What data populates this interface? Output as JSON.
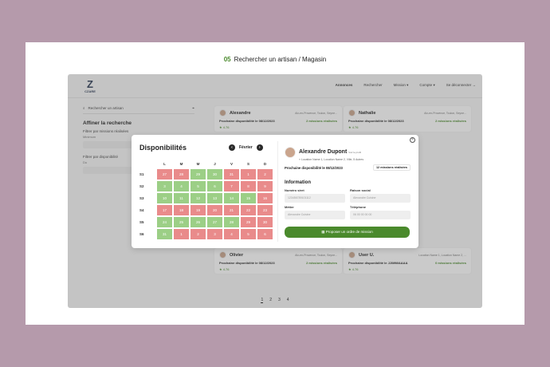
{
  "heading": {
    "number": "05",
    "title": "Rechercher un artisan / Magasin"
  },
  "logo": {
    "mark": "Z",
    "text": "CZARE"
  },
  "nav": {
    "items": [
      "Annonces",
      "Rechercher",
      "Mission",
      "Compte",
      "Se déconnecter"
    ],
    "active_index": 0
  },
  "search": {
    "placeholder": "Rechercher un artisan"
  },
  "filters": {
    "title": "Affiner la recherche",
    "missions_label": "Filtrer par missions réalisées",
    "missions_sub": "Minimum",
    "availability_label": "Filtrer par disponibilité",
    "availability_sub": "Du"
  },
  "cards": [
    {
      "name": "Alexandre",
      "location": "Aix-en-Provence, Toulon, Seyne...",
      "availability": "Prochaine disponibilité le 08/12/2023",
      "missions": "2 missions réalisées",
      "rating": "4.76"
    },
    {
      "name": "Nathalie",
      "location": "Aix-en-Provence, Toulon, Seyne...",
      "availability": "Prochaine disponibilité le 08/12/2023",
      "missions": "2 missions réalisées",
      "rating": "4.76"
    },
    {
      "name": "Olivier",
      "location": "Aix-en-Provence, Toulon, Seyne...",
      "availability": "Prochaine disponibilité le 08/12/2023",
      "missions": "2 missions réalisées",
      "rating": "4.76"
    },
    {
      "name": "User U.",
      "location": "Location Name 1, Location Name 2, ...",
      "availability": "Prochaine disponibilité le JJ/MM/AAAA",
      "missions": "0 missions réalisées",
      "rating": "4.76"
    }
  ],
  "pagination": {
    "pages": [
      "1",
      "2",
      "3",
      "4"
    ],
    "current": "1"
  },
  "modal": {
    "calendar": {
      "title": "Disponibilités",
      "month": "Février",
      "weekdays": [
        "L",
        "M",
        "M",
        "J",
        "V",
        "S",
        "D"
      ],
      "weeks": [
        {
          "label": "S1",
          "days": [
            {
              "d": "27",
              "s": "red"
            },
            {
              "d": "28",
              "s": "red"
            },
            {
              "d": "29",
              "s": "green"
            },
            {
              "d": "30",
              "s": "green"
            },
            {
              "d": "31",
              "s": "red"
            },
            {
              "d": "1",
              "s": "red"
            },
            {
              "d": "2",
              "s": "red"
            }
          ]
        },
        {
          "label": "S2",
          "days": [
            {
              "d": "3",
              "s": "green"
            },
            {
              "d": "4",
              "s": "green"
            },
            {
              "d": "5",
              "s": "green"
            },
            {
              "d": "6",
              "s": "green"
            },
            {
              "d": "7",
              "s": "red"
            },
            {
              "d": "8",
              "s": "red"
            },
            {
              "d": "9",
              "s": "red"
            }
          ]
        },
        {
          "label": "S3",
          "days": [
            {
              "d": "10",
              "s": "green"
            },
            {
              "d": "11",
              "s": "green"
            },
            {
              "d": "12",
              "s": "green"
            },
            {
              "d": "13",
              "s": "green"
            },
            {
              "d": "14",
              "s": "green"
            },
            {
              "d": "15",
              "s": "green"
            },
            {
              "d": "16",
              "s": "red"
            }
          ]
        },
        {
          "label": "S4",
          "days": [
            {
              "d": "17",
              "s": "red"
            },
            {
              "d": "18",
              "s": "red"
            },
            {
              "d": "19",
              "s": "red"
            },
            {
              "d": "20",
              "s": "red"
            },
            {
              "d": "21",
              "s": "red"
            },
            {
              "d": "22",
              "s": "red"
            },
            {
              "d": "23",
              "s": "red"
            }
          ]
        },
        {
          "label": "S5",
          "days": [
            {
              "d": "24",
              "s": "green"
            },
            {
              "d": "25",
              "s": "green"
            },
            {
              "d": "26",
              "s": "green"
            },
            {
              "d": "27",
              "s": "green"
            },
            {
              "d": "28",
              "s": "green"
            },
            {
              "d": "29",
              "s": "red"
            },
            {
              "d": "30",
              "s": "red"
            }
          ]
        },
        {
          "label": "S6",
          "days": [
            {
              "d": "31",
              "s": "green"
            },
            {
              "d": "1",
              "s": "red"
            },
            {
              "d": "2",
              "s": "red"
            },
            {
              "d": "3",
              "s": "red"
            },
            {
              "d": "4",
              "s": "red"
            },
            {
              "d": "5",
              "s": "red"
            },
            {
              "d": "6",
              "s": "red"
            }
          ]
        }
      ]
    },
    "profile": {
      "name": "Alexandre Dupont",
      "tag": "Voir le profil",
      "location": "Location Name 1, Location Name 2, Ville, 5 Autres",
      "availability": "Prochaine disponibilité le 08/12/2023",
      "missions": "12 missions réalisées",
      "info_title": "Information",
      "fields": [
        {
          "label": "Numéro siret",
          "value": "123456789101112"
        },
        {
          "label": "Raison social",
          "value": "Alexandre Cuisine"
        },
        {
          "label": "Métier",
          "value": "Alexandre Cuisine"
        },
        {
          "label": "Téléphone",
          "value": "06 00 00 00 00"
        }
      ],
      "cta": "Proposer un ordre de mission"
    }
  },
  "colors": {
    "accent": "#4a8a2c",
    "available": "#9ccf86",
    "unavailable": "#e98b8b",
    "background": "#b59aab"
  }
}
